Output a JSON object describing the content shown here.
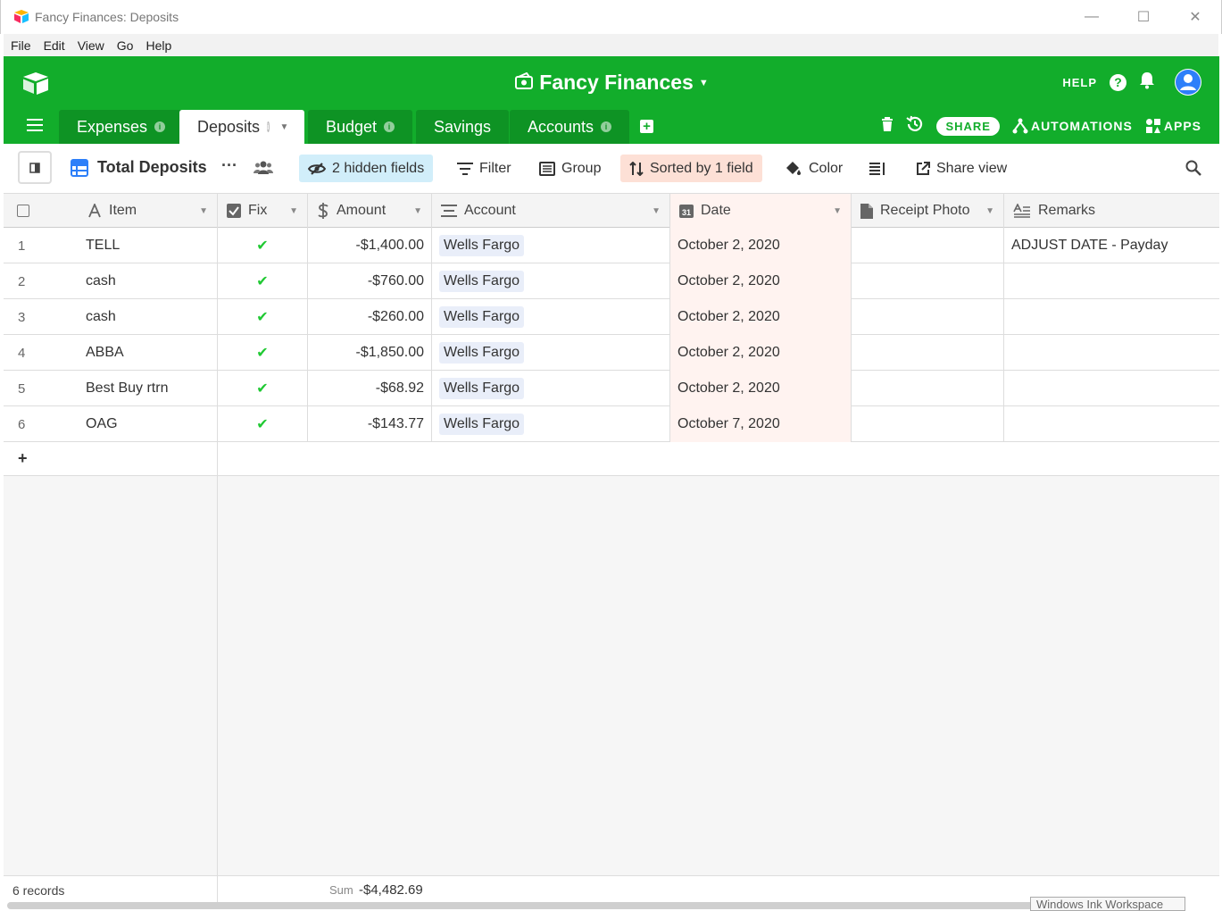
{
  "window": {
    "title": "Fancy Finances: Deposits",
    "minimize": "—",
    "maximize": "☐",
    "close": "✕"
  },
  "menu": [
    "File",
    "Edit",
    "View",
    "Go",
    "Help"
  ],
  "header": {
    "base_name": "Fancy Finances",
    "help_label": "HELP",
    "help_glyph": "?",
    "bg_color": "#12ad2b"
  },
  "tabs": [
    {
      "label": "Expenses",
      "info": "i"
    },
    {
      "label": "Deposits",
      "info": "i"
    },
    {
      "label": "Budget",
      "info": "i"
    },
    {
      "label": "Savings"
    },
    {
      "label": "Accounts",
      "info": "i"
    }
  ],
  "tab_actions": {
    "add": "+",
    "share": "SHARE",
    "automations": "AUTOMATIONS",
    "apps": "APPS"
  },
  "view": {
    "name": "Total Deposits",
    "more": "···",
    "hidden_fields": "2 hidden fields",
    "filter": "Filter",
    "group": "Group",
    "sorted": "Sorted by 1 field",
    "color": "Color",
    "share_view": "Share view"
  },
  "columns": [
    "Item",
    "Fix",
    "Amount",
    "Account",
    "Date",
    "Receipt Photo",
    "Remarks"
  ],
  "rows": [
    {
      "n": "1",
      "item": "TELL",
      "fix": "✔",
      "amount": "-$1,400.00",
      "account": "Wells Fargo",
      "date": "October 2, 2020",
      "remarks": "ADJUST DATE - Payday"
    },
    {
      "n": "2",
      "item": "cash",
      "fix": "✔",
      "amount": "-$760.00",
      "account": "Wells Fargo",
      "date": "October 2, 2020",
      "remarks": ""
    },
    {
      "n": "3",
      "item": "cash",
      "fix": "✔",
      "amount": "-$260.00",
      "account": "Wells Fargo",
      "date": "October 2, 2020",
      "remarks": ""
    },
    {
      "n": "4",
      "item": "ABBA",
      "fix": "✔",
      "amount": "-$1,850.00",
      "account": "Wells Fargo",
      "date": "October 2, 2020",
      "remarks": ""
    },
    {
      "n": "5",
      "item": "Best Buy rtrn",
      "fix": "✔",
      "amount": "-$68.92",
      "account": "Wells Fargo",
      "date": "October 2, 2020",
      "remarks": ""
    },
    {
      "n": "6",
      "item": "OAG",
      "fix": "✔",
      "amount": "-$143.77",
      "account": "Wells Fargo",
      "date": "October 7, 2020",
      "remarks": ""
    }
  ],
  "add_row": "+",
  "footer": {
    "records": "6 records",
    "sum_label": "Sum",
    "sum_value": "-$4,482.69"
  },
  "taskbar_tooltip": "Windows Ink Workspace"
}
